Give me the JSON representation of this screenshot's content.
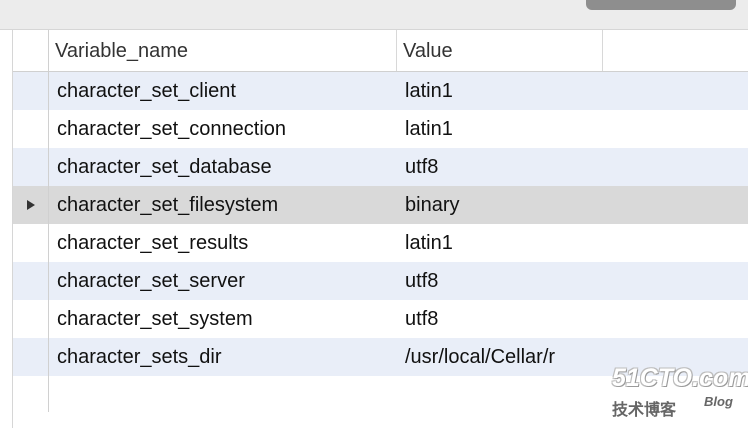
{
  "table": {
    "columns": [
      "Variable_name",
      "Value"
    ],
    "rows": [
      {
        "name": "character_set_client",
        "value": "latin1"
      },
      {
        "name": "character_set_connection",
        "value": "latin1"
      },
      {
        "name": "character_set_database",
        "value": "utf8"
      },
      {
        "name": "character_set_filesystem",
        "value": "binary"
      },
      {
        "name": "character_set_results",
        "value": "latin1"
      },
      {
        "name": "character_set_server",
        "value": "utf8"
      },
      {
        "name": "character_set_system",
        "value": "utf8"
      },
      {
        "name": "character_sets_dir",
        "value": "/usr/local/Cellar/r"
      }
    ],
    "selected_row": 3
  },
  "watermark": {
    "main": "51CTO.com",
    "sub": "技术博客",
    "blog": "Blog"
  },
  "colors": {
    "stripe": "#e9eef8",
    "selected": "#d9d9d9",
    "grid_line": "#d0d0d0"
  },
  "icons": {
    "row_indicator": "triangle-right-icon"
  }
}
